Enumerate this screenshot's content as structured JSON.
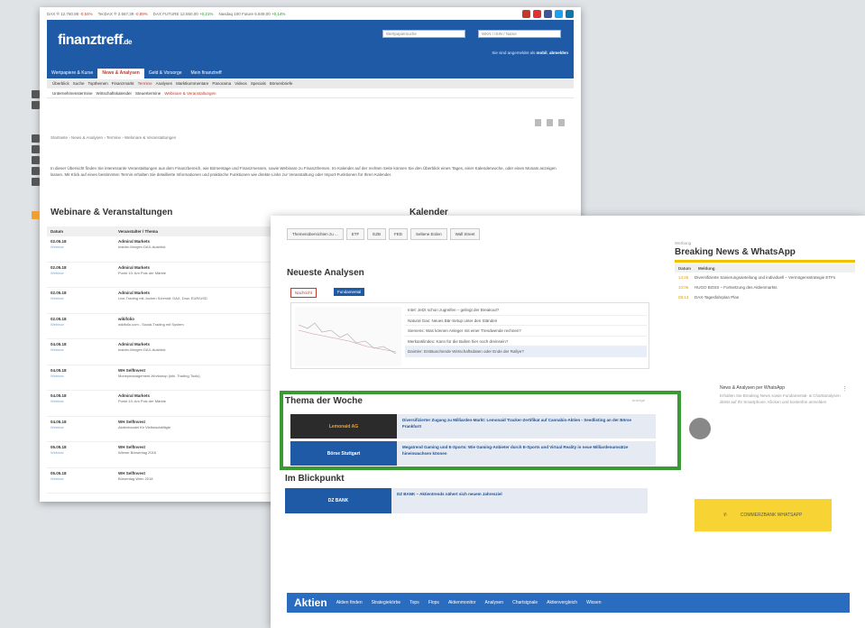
{
  "ticker": {
    "items": [
      {
        "text": "DAX ® 12.760,98",
        "chg": "-0,54%",
        "dir": "dn"
      },
      {
        "text": "TecDAX ® 2.567,39",
        "chg": "-0,89%",
        "dir": "dn"
      },
      {
        "text": "DAX FUTURE 12.550,00",
        "chg": "+0,21%",
        "dir": "up"
      },
      {
        "text": "Nasdaq 100 Future 6.849,00",
        "chg": "+0,14%",
        "dir": "up"
      }
    ],
    "social_colors": [
      "#c0392b",
      "#d33",
      "#3b5998",
      "#1da1f2",
      "#0e76a8"
    ]
  },
  "header": {
    "logo": "finanztreff",
    "logo_suffix": ".de",
    "search_placeholder": "Wertpapiersuche",
    "select_label": "WKN / ISIN / Name",
    "login_text": "Sie sind angemeldet als",
    "login_user": "mobil",
    "logout": "abmelden"
  },
  "nav1": [
    "Wertpapiere & Kurse",
    "News & Analysen",
    "Geld & Vorsorge",
    "Mein finanztreff"
  ],
  "nav1_active": 1,
  "nav2": [
    "Überblick",
    "Suche",
    "Topthemen",
    "Finanzmarkt",
    "Termine",
    "Analysen",
    "Marktkommentare",
    "Panorama",
    "Videos",
    "Specials",
    "Börsenbriefe"
  ],
  "nav2_active": 4,
  "nav3": [
    "Unternehmenstermine",
    "Wirtschaftskalender",
    "Steuertermine",
    "Webinare & Veranstaltungen"
  ],
  "nav3_active": 3,
  "breadcrumb": "Startseite › News & Analysen › Termine › Webinare & Veranstaltungen",
  "intro": "In dieser Übersicht finden Sie interessante Veranstaltungen aus dem Finanzbereich, wie Börsentage und Finanzmessen, sowie Webinare zu Finanzthemen. Im Kalender auf der rechten Seite können Sie den Überblick eines Tages, einer Kalenderwoche, oder eines Monats anzeigen lassen. Mit Klick auf einen bestimmten Termin erhalten Sie detaillierte Informationen und praktische Funktionen wie direkte Links zur Veranstaltung oder Import-Funktionen für Ihren Kalender.",
  "webinare": {
    "title": "Webinare & Veranstaltungen",
    "calendar_title": "Kalender",
    "col_date": "Datum",
    "col_org": "Veranstalter / Thema",
    "rows": [
      {
        "date": "02.05.18",
        "type": "Webinar",
        "org": "Admiral Markets",
        "topic": "Insider-Morgen DAX-Ausblick"
      },
      {
        "date": "02.05.18",
        "type": "Webinar",
        "org": "Admiral Markets",
        "topic": "Punkt 10: Am Puls der Märkte"
      },
      {
        "date": "02.05.18",
        "type": "Webinar",
        "org": "Admiral Markets",
        "topic": "Live-Trading mit Jochen Schmidt: DAX, Dow, EUR/USD"
      },
      {
        "date": "02.05.18",
        "type": "Webinar",
        "org": "wikifolio",
        "topic": "wikifolio.com - Social-Trading mit System"
      },
      {
        "date": "04.05.18",
        "type": "Webinar",
        "org": "Admiral Markets",
        "topic": "Insider-Morgen DAX-Ausblick"
      },
      {
        "date": "04.05.18",
        "type": "Webinar",
        "org": "WH SelfInvest",
        "topic": "Moneymanagement-Workshop (inkl. Trading-Tools)"
      },
      {
        "date": "04.05.18",
        "type": "Webinar",
        "org": "Admiral Markets",
        "topic": "Punkt 10: Am Puls der Märkte"
      },
      {
        "date": "04.05.18",
        "type": "Webinar",
        "org": "WH SelfInvest",
        "topic": "Aktienhandel für Vielbeschäftigte"
      },
      {
        "date": "05.05.18",
        "type": "Webinar",
        "org": "WH SelfInvest",
        "topic": "Wiener Börsentag 2018"
      },
      {
        "date": "05.05.18",
        "type": "Webinar",
        "org": "WH SelfInvest",
        "topic": "Börsentag Wien 2018"
      }
    ]
  },
  "front": {
    "tabs": [
      "Themenübersichten zu ...",
      "ETF",
      "EZB",
      "FED",
      "Seltene Erden",
      "Wall Street"
    ],
    "neueste_title": "Neueste Analysen",
    "pill_a": "Nachricht",
    "pill_b": "Fundamental",
    "analysen": [
      "Intel: Jetzt schon zugreifen – gelingt der Breakout?",
      "Natural Gas: Neues Bär-Setup unter den Ständen",
      "Siemens: Was können Anleger mit einer Trendwende rechnen?",
      "Merkantilindex: Kann für die Bullen hier noch dreinsein?",
      "Daimler: Enttäuschende Wirtschaftsdaten oder Ende der Rallye?"
    ],
    "thema_title": "Thema der Woche",
    "thema_tag": "Anzeige",
    "thema_rows": [
      {
        "label": "Lemonaid AG",
        "text": "Diversifizierter Zugang zu Milliarden-Markt: Lemonaid Tracker-Zertifikat auf Cannabis-Aktien - Seedlisting an der Börse Frankfurt!",
        "bg": "#2b2b2b",
        "fg": "#f0a030"
      },
      {
        "label": "Börse Stuttgart",
        "text": "Megatrend Gaming und E-Sports: Wie Gaming-Anbieter durch E-Sports und Virtual Reality in neue Milliardenumsätze hineinwachsen können",
        "bg": "#1f5aa6",
        "fg": "#fff"
      }
    ],
    "blick_title": "Im Blickpunkt",
    "blick_label": "DZ BANK",
    "blick_text": "DZ BANK – Aktientrends nähert sich neuem Jahresziel",
    "aktien_title": "Aktien",
    "aktien_links": [
      "Aktien finden",
      "Strategiekörbe",
      "Tops",
      "Flops",
      "Aktienmonitor",
      "Analysen",
      "Chartsignale",
      "Aktienvergleich",
      "Wissen"
    ]
  },
  "right": {
    "werbung": "Werbung",
    "title": "Breaking News & WhatsApp",
    "col_date": "Datum",
    "col_msg": "Meldung",
    "rows": [
      {
        "time": "14:26",
        "text": "Diversifizierte Sanierungsanteilung und individuell – Vermögensstrategie ETFs"
      },
      {
        "time": "10:06",
        "text": "HUGO BOSS – Fortsetzung des Aktienmarkts"
      },
      {
        "time": "08:13",
        "text": "DAX-Tagesfahrplan Plan"
      }
    ],
    "wa_title": "News & Analysen per WhatsApp",
    "wa_text": "Erhalten Sie Breaking News sowie Fundamental- & Charttanalysen direkt auf Ihr Smartphone. Klicken und kostenfrei anmelden",
    "wa_button": "COMMERZBANK WHATSAPP"
  }
}
